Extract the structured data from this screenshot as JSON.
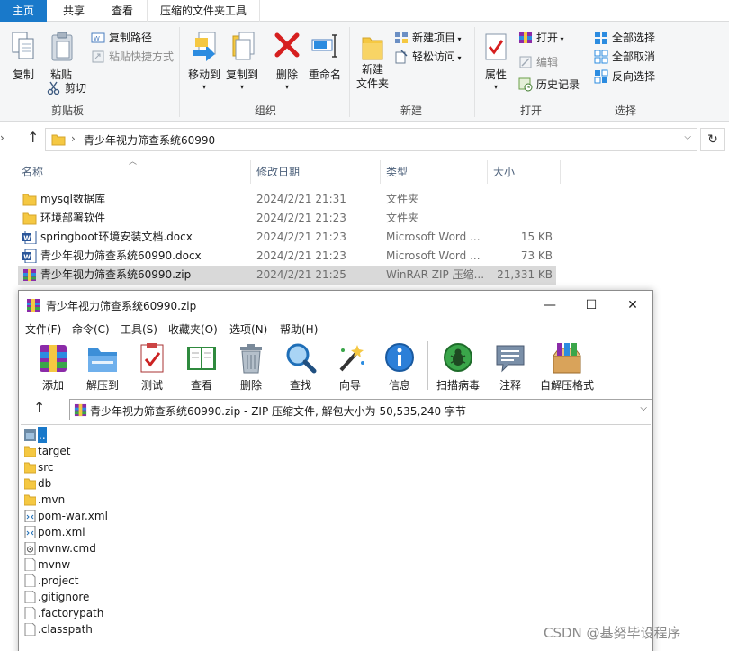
{
  "ribbon_tabs": [
    {
      "label": "主页",
      "active": true
    },
    {
      "label": "共享",
      "active": false
    },
    {
      "label": "查看",
      "active": false
    },
    {
      "label": "压缩的文件夹工具",
      "active": false
    }
  ],
  "ribbon": {
    "clipboard": {
      "copy": "复制",
      "paste": "粘贴",
      "copy_path": "复制路径",
      "paste_shortcut": "粘贴快捷方式",
      "cut": "剪切",
      "group": "剪贴板"
    },
    "organize": {
      "move_to": "移动到",
      "copy_to": "复制到",
      "delete": "删除",
      "rename": "重命名",
      "group": "组织"
    },
    "new": {
      "new_folder_line1": "新建",
      "new_folder_line2": "文件夹",
      "new_item": "新建项目",
      "easy_access": "轻松访问",
      "group": "新建"
    },
    "open": {
      "properties": "属性",
      "open": "打开",
      "edit": "编辑",
      "history": "历史记录",
      "group": "打开"
    },
    "select": {
      "select_all": "全部选择",
      "select_none": "全部取消",
      "invert": "反向选择",
      "group": "选择"
    }
  },
  "address": {
    "path": "青少年视力筛查系统60990",
    "separator": "›"
  },
  "columns": {
    "name": "名称",
    "date": "修改日期",
    "type": "类型",
    "size": "大小"
  },
  "files": [
    {
      "name": "mysql数据库",
      "date": "2024/2/21 21:31",
      "type": "文件夹",
      "size": "",
      "icon": "folder-icon",
      "selected": false
    },
    {
      "name": "环境部署软件",
      "date": "2024/2/21 21:23",
      "type": "文件夹",
      "size": "",
      "icon": "folder-icon",
      "selected": false
    },
    {
      "name": "springboot环境安装文档.docx",
      "date": "2024/2/21 21:23",
      "type": "Microsoft Word ...",
      "size": "15 KB",
      "icon": "word-icon",
      "selected": false
    },
    {
      "name": "青少年视力筛查系统60990.docx",
      "date": "2024/2/21 21:23",
      "type": "Microsoft Word ...",
      "size": "73 KB",
      "icon": "word-icon",
      "selected": false
    },
    {
      "name": "青少年视力筛查系统60990.zip",
      "date": "2024/2/21 21:25",
      "type": "WinRAR ZIP 压缩...",
      "size": "21,331 KB",
      "icon": "winrar-icon",
      "selected": true
    }
  ],
  "rar": {
    "title": "青少年视力筛查系统60990.zip",
    "minimize": "—",
    "maximize": "☐",
    "close": "✕",
    "menu": [
      "文件(F)",
      "命令(C)",
      "工具(S)",
      "收藏夹(O)",
      "选项(N)",
      "帮助(H)"
    ],
    "tools": [
      {
        "label": "添加",
        "icon": "add-archive-icon"
      },
      {
        "label": "解压到",
        "icon": "extract-to-icon"
      },
      {
        "label": "测试",
        "icon": "test-icon"
      },
      {
        "label": "查看",
        "icon": "view-book-icon"
      },
      {
        "label": "删除",
        "icon": "trash-icon"
      },
      {
        "label": "查找",
        "icon": "magnifier-icon"
      },
      {
        "label": "向导",
        "icon": "wizard-wand-icon"
      },
      {
        "label": "信息",
        "icon": "info-icon"
      },
      {
        "label": "扫描病毒",
        "icon": "virus-scan-icon"
      },
      {
        "label": "注释",
        "icon": "comment-icon"
      },
      {
        "label": "自解压格式",
        "icon": "sfx-box-icon"
      }
    ],
    "path": "青少年视力筛查系统60990.zip - ZIP 压缩文件, 解包大小为 50,535,240 字节",
    "entries": [
      {
        "name": "..",
        "kind": "up"
      },
      {
        "name": "target",
        "kind": "folder"
      },
      {
        "name": "src",
        "kind": "folder"
      },
      {
        "name": "db",
        "kind": "folder"
      },
      {
        "name": ".mvn",
        "kind": "folder"
      },
      {
        "name": "pom-war.xml",
        "kind": "xml"
      },
      {
        "name": "pom.xml",
        "kind": "xml"
      },
      {
        "name": "mvnw.cmd",
        "kind": "cmd"
      },
      {
        "name": "mvnw",
        "kind": "file"
      },
      {
        "name": ".project",
        "kind": "file"
      },
      {
        "name": ".gitignore",
        "kind": "file"
      },
      {
        "name": ".factorypath",
        "kind": "file"
      },
      {
        "name": ".classpath",
        "kind": "file"
      }
    ]
  },
  "watermark": "CSDN @基努毕设程序",
  "colors": {
    "accent": "#1979ca",
    "folder": "#f5c842",
    "selection": "#d9d9d9"
  }
}
